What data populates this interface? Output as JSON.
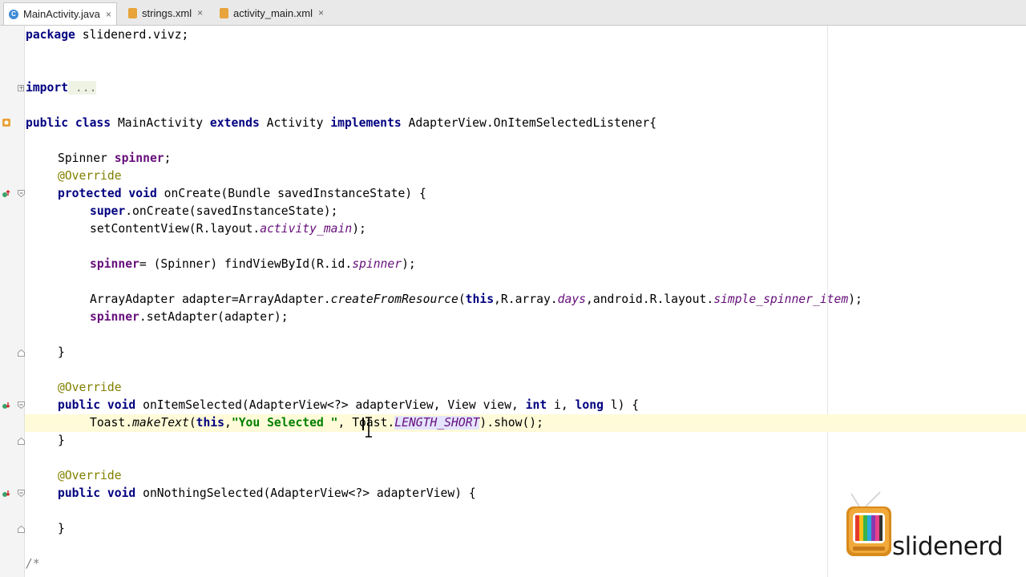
{
  "tabs": [
    {
      "label": "MainActivity.java",
      "icon": "java-class-icon",
      "active": true
    },
    {
      "label": "strings.xml",
      "icon": "xml-file-icon",
      "active": false
    },
    {
      "label": "activity_main.xml",
      "icon": "xml-file-icon",
      "active": false
    }
  ],
  "tab_close_glyph": "×",
  "code": {
    "l1_kw": "package",
    "l1_rest": " slidenerd.vivz;",
    "l2_kw": "import",
    "l2_fold": " ...",
    "l3": {
      "t1": "public class",
      "t2": " MainActivity ",
      "t3": "extends",
      "t4": " Activity ",
      "t5": "implements",
      "t6": " AdapterView.OnItemSelectedListener{"
    },
    "l4": {
      "t1": "Spinner ",
      "t2": "spinner",
      "t3": ";"
    },
    "l5": "@Override",
    "l6": {
      "t1": "protected void",
      "t2": " onCreate(Bundle savedInstanceState) {"
    },
    "l7": {
      "t1": "super",
      "t2": ".onCreate(savedInstanceState);"
    },
    "l8": {
      "t1": "setContentView(R.layout.",
      "t2": "activity_main",
      "t3": ");"
    },
    "l9": {
      "t1": "spinner",
      "t2": "= (Spinner) findViewById(R.id.",
      "t3": "spinner",
      "t4": ");"
    },
    "l10": {
      "t1": "ArrayAdapter adapter=ArrayAdapter.",
      "t2": "createFromResource",
      "t3": "(",
      "t4": "this",
      "t5": ",R.array.",
      "t6": "days",
      "t7": ",android.R.layout.",
      "t8": "simple_spinner_item",
      "t9": ");"
    },
    "l11": {
      "t1": "spinner",
      "t2": ".setAdapter(adapter);"
    },
    "l12": "}",
    "l13": "@Override",
    "l14": {
      "t1": "public void",
      "t2": " onItemSelected(AdapterView<?> adapterView, View view, ",
      "t3": "int",
      "t4": " i, ",
      "t5": "long",
      "t6": " l) {"
    },
    "l15": {
      "t1": "Toast.",
      "t2": "makeText",
      "t3": "(",
      "t4": "this",
      "t5": ",",
      "t6": "\"You Selected \"",
      "t7": ", Toast.",
      "t8": "LENGTH_SHORT",
      "t9": ").show();"
    },
    "l16": "}",
    "l17": "@Override",
    "l18": {
      "t1": "public void",
      "t2": " onNothingSelected(AdapterView<?> adapterView) {"
    },
    "l19": "}",
    "l20": "/*"
  },
  "watermark": {
    "text": "slidenerd",
    "icon": "retro-tv-icon"
  },
  "colors": {
    "keyword": "#000080",
    "annotation": "#808000",
    "field": "#660e7a",
    "string": "#008000",
    "caret_line": "#fffbd8"
  }
}
